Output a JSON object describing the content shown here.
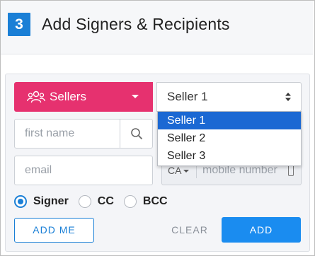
{
  "header": {
    "step_number": "3",
    "title": "Add Signers & Recipients"
  },
  "group_selector": {
    "label": "Sellers",
    "icon": "people-icon",
    "color": "#e6316f"
  },
  "seller_select": {
    "value": "Seller 1",
    "options": [
      "Seller 1",
      "Seller 2",
      "Seller 3"
    ],
    "selected_index": 0
  },
  "form": {
    "first_name_placeholder": "first name",
    "email_placeholder": "email",
    "country_code": "CA",
    "mobile_placeholder": "mobile number"
  },
  "role": {
    "options": [
      "Signer",
      "CC",
      "BCC"
    ],
    "selected": "Signer"
  },
  "buttons": {
    "add_me": "ADD ME",
    "clear": "CLEAR",
    "add": "ADD"
  },
  "colors": {
    "accent": "#1a7fd6",
    "selected_option": "#1b68d3"
  }
}
